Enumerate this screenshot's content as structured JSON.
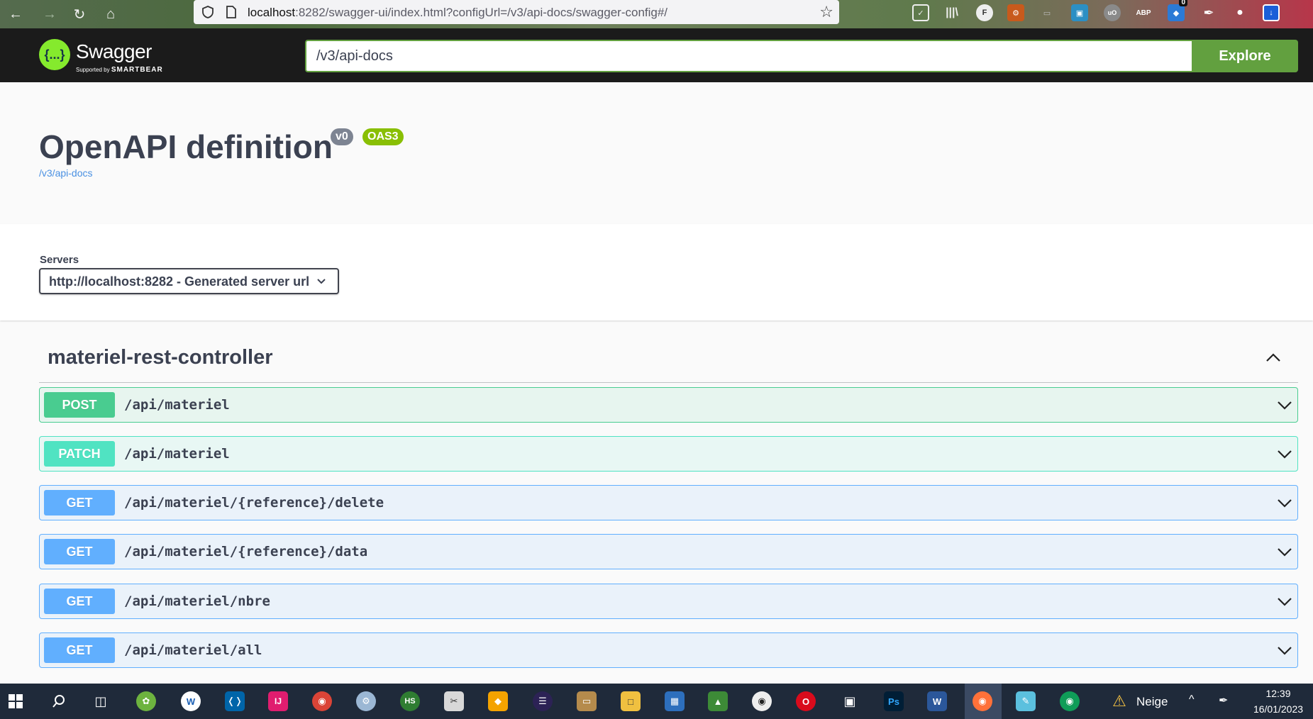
{
  "browser": {
    "url_host": "localhost",
    "url_rest": ":8282/swagger-ui/index.html?configUrl=/v3/api-docs/swagger-config#/",
    "extension_badge": "0"
  },
  "topbar": {
    "logo_text": "Swagger",
    "logo_sub_prefix": "Supported by",
    "logo_sub_brand": "SMARTBEAR",
    "logo_glyph": "{...}",
    "spec_url_value": "/v3/api-docs",
    "explore_label": "Explore"
  },
  "info": {
    "title": "OpenAPI definition",
    "version_badge": "v0",
    "oas_badge": "OAS3",
    "spec_link": "/v3/api-docs"
  },
  "servers": {
    "label": "Servers",
    "selected": "http://localhost:8282 - Generated server url"
  },
  "tag": {
    "name": "materiel-rest-controller"
  },
  "operations": [
    {
      "method": "POST",
      "path": "/api/materiel"
    },
    {
      "method": "PATCH",
      "path": "/api/materiel"
    },
    {
      "method": "GET",
      "path": "/api/materiel/{reference}/delete"
    },
    {
      "method": "GET",
      "path": "/api/materiel/{reference}/data"
    },
    {
      "method": "GET",
      "path": "/api/materiel/nbre"
    },
    {
      "method": "GET",
      "path": "/api/materiel/all"
    }
  ],
  "taskbar": {
    "weather_text": "Neige",
    "time": "12:39",
    "date": "16/01/2023"
  },
  "colors": {
    "post": "#49cc90",
    "patch": "#50e3c2",
    "get": "#61affe",
    "explore": "#62a03f",
    "topbar": "#1b1b1b"
  }
}
